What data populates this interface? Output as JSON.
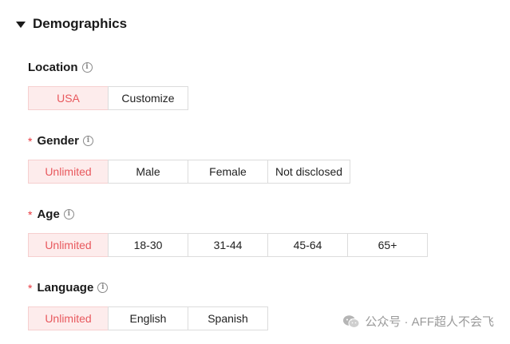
{
  "section": {
    "title": "Demographics"
  },
  "location": {
    "label": "Location",
    "required": false,
    "options": [
      "USA",
      "Customize"
    ],
    "selected": "USA"
  },
  "gender": {
    "required_mark": "*",
    "label": "Gender",
    "options": [
      "Unlimited",
      "Male",
      "Female",
      "Not disclosed"
    ],
    "selected": "Unlimited"
  },
  "age": {
    "required_mark": "*",
    "label": "Age",
    "options": [
      "Unlimited",
      "18-30",
      "31-44",
      "45-64",
      "65+"
    ],
    "selected": "Unlimited"
  },
  "language": {
    "required_mark": "*",
    "label": "Language",
    "options": [
      "Unlimited",
      "English",
      "Spanish"
    ],
    "selected": "Unlimited"
  },
  "watermark": {
    "text": "公众号 · AFF超人不会飞"
  },
  "colors": {
    "accent": "#e8585d",
    "selected_bg": "#fdecec",
    "required": "#e8363d",
    "border": "#dcdcdc"
  },
  "icons": {
    "caret": "caret-down-icon",
    "info": "info-icon",
    "watermark": "wechat-icon"
  }
}
